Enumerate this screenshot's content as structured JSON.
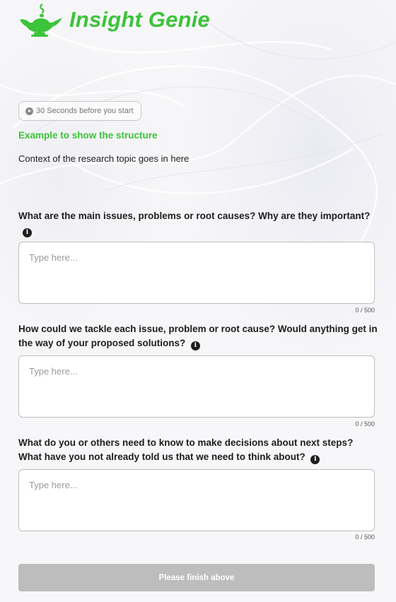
{
  "app": {
    "name": "Insight Genie",
    "brand_color": "#3cc43a",
    "logo_icon": "genie-lamp-icon"
  },
  "timer": {
    "label": "30 Seconds before you start",
    "icon": "play-icon"
  },
  "example": {
    "title": "Example to show the structure",
    "context": "Context of the research topic goes in here"
  },
  "questions": [
    {
      "text": "What are the main issues, problems or root causes? Why are they important?",
      "placeholder": "Type here...",
      "counter": "0 / 500"
    },
    {
      "text": "How could we tackle each issue, problem or root cause? Would anything get in the way of your proposed solutions?",
      "placeholder": "Type here...",
      "counter": "0 / 500"
    },
    {
      "text": "What do you or others need to know to make decisions about next steps? What have you not already told us that we need to think about?",
      "placeholder": "Type here...",
      "counter": "0 / 500"
    }
  ],
  "info_icon": "i",
  "submit": {
    "label": "Please finish above",
    "color": "#bdbdbd"
  }
}
